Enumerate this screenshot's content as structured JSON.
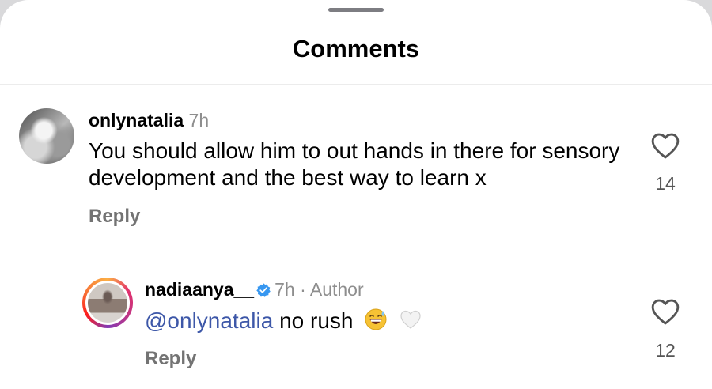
{
  "sheet": {
    "title": "Comments"
  },
  "comments": [
    {
      "username": "onlynatalia",
      "time": "7h",
      "text": "You should allow him to out hands in there for sensory development and the best way to learn x",
      "reply_label": "Reply",
      "likes": "14"
    },
    {
      "username": "nadiaanya__",
      "time": "7h · Author",
      "mention": "@onlynatalia",
      "text": " no rush",
      "emojis": [
        "grinning-sweat-emoji",
        "white-heart-emoji"
      ],
      "reply_label": "Reply",
      "likes": "12",
      "verified": true
    }
  ],
  "colors": {
    "mention": "#3d57a8",
    "verified": "#3797f0",
    "meta": "#8e8e8e"
  }
}
